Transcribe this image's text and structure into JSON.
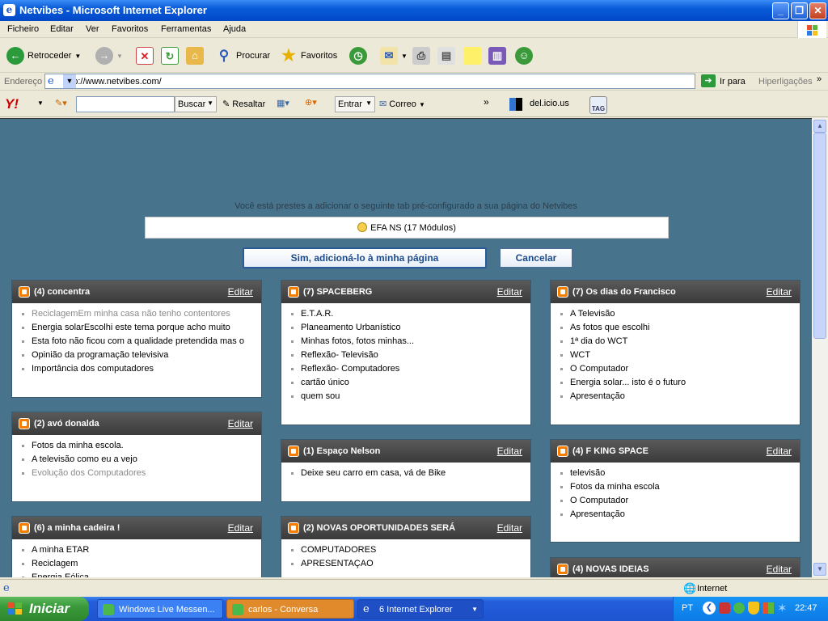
{
  "window": {
    "title": "Netvibes - Microsoft Internet Explorer"
  },
  "menu": [
    "Ficheiro",
    "Editar",
    "Ver",
    "Favoritos",
    "Ferramentas",
    "Ajuda"
  ],
  "toolbar": {
    "back": "Retroceder",
    "search": "Procurar",
    "favorites": "Favoritos"
  },
  "address": {
    "label": "Endereço",
    "url": "http://www.netvibes.com/",
    "go": "Ir para",
    "links": "Hiperligações"
  },
  "yahoo": {
    "search_button": "Buscar",
    "highlight": "Resaltar",
    "signin": "Entrar",
    "mail": "Correo",
    "delicious": "del.icio.us",
    "tag": "TAG"
  },
  "page": {
    "prompt": "Você está prestes a adicionar o seguinte tab pré-configurado a sua página do Netvibes",
    "tab_name": "EFA NS (17 Módulos)",
    "confirm_button": "Sim, adicioná-lo à minha página",
    "cancel_button": "Cancelar",
    "edit_label": "Editar",
    "modules": [
      {
        "title": "(4) concentra",
        "items": [
          "ReciclagemEm minha casa não tenho contentores",
          "Energia solarEscolhi este tema porque acho muito",
          "Esta foto não ficou com a qualidade pretendida mas o",
          "Opinião da programação televisiva",
          "Importância dos computadores"
        ]
      },
      {
        "title": "(2) avó donalda",
        "items": [
          "Fotos da minha escola.",
          "A televisão como eu a vejo",
          "Evolução dos Computadores"
        ]
      },
      {
        "title": "(6) a minha cadeira !",
        "items": [
          "A minha ETAR",
          "Reciclagem",
          "Energia Eólica"
        ]
      },
      {
        "title": "(7) SPACEBERG",
        "items": [
          "E.T.A.R.",
          "Planeamento Urbanístico",
          "Minhas fotos, fotos minhas...",
          "Reflexão- Televisão",
          "Reflexão- Computadores",
          "cartão único",
          "quem sou"
        ]
      },
      {
        "title": "(1) Espaço Nelson",
        "items": [
          "Deixe seu carro em casa, vá de Bike"
        ]
      },
      {
        "title": "(2) NOVAS OPORTUNIDADES SERÁ",
        "items": [
          "COMPUTADORES",
          "APRESENTAÇAO"
        ]
      },
      {
        "title": "(7) Os dias do Francisco",
        "items": [
          "A Televisão",
          "As fotos que escolhi",
          "1ª dia do WCT",
          "WCT",
          "O Computador",
          "Energia solar... isto é o futuro",
          "Apresentação"
        ]
      },
      {
        "title": "(4) F KING SPACE",
        "items": [
          "televisão",
          "Fotos da minha escola",
          "O Computador",
          "Apresentação"
        ]
      },
      {
        "title": "(4) NOVAS IDEIAS",
        "items": []
      }
    ]
  },
  "status": {
    "zone": "Internet"
  },
  "taskbar": {
    "start": "Iniciar",
    "tasks": [
      "Windows Live Messen...",
      "carlos - Conversa",
      "6 Internet Explorer"
    ],
    "lang": "PT",
    "clock": "22:47"
  }
}
